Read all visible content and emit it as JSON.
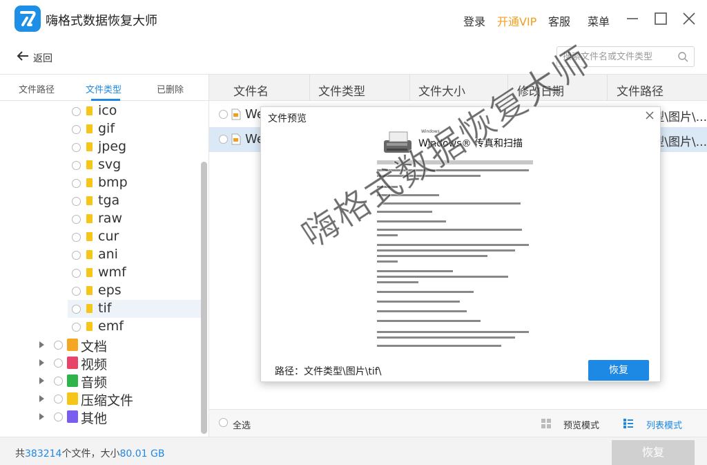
{
  "app": {
    "title": "嗨格式数据恢复大师"
  },
  "titlebar": {
    "login": "登录",
    "vip": "开通VIP",
    "service": "客服",
    "menu": "菜单"
  },
  "nav": {
    "back": "返回"
  },
  "search": {
    "placeholder": "搜索文件名或文件类型"
  },
  "left_tabs": {
    "path": "文件路径",
    "type": "文件类型",
    "deleted": "已删除",
    "active": "type"
  },
  "tree": {
    "extensions": [
      "ico",
      "gif",
      "jpeg",
      "svg",
      "bmp",
      "tga",
      "raw",
      "cur",
      "ani",
      "wmf",
      "eps",
      "tif",
      "emf"
    ],
    "selected": "tif",
    "categories": [
      {
        "label": "文档",
        "icon": "document-icon",
        "color": "#f5a623"
      },
      {
        "label": "视频",
        "icon": "video-icon",
        "color": "#e8446a"
      },
      {
        "label": "音频",
        "icon": "audio-icon",
        "color": "#2fb44a"
      },
      {
        "label": "压缩文件",
        "icon": "zip-icon",
        "color": "#f5c518"
      },
      {
        "label": "其他",
        "icon": "other-icon",
        "color": "#7b5cf0"
      }
    ]
  },
  "table": {
    "columns": [
      "文件名",
      "文件类型",
      "文件大小",
      "修改日期",
      "文件路径"
    ],
    "rows": [
      {
        "name": "We",
        "path": "型\\图片\\..."
      },
      {
        "name": "We",
        "path": "型\\图片\\..."
      }
    ],
    "selected_row": 1
  },
  "footer": {
    "select_all": "全选",
    "preview_mode": "预览模式",
    "list_mode": "列表模式"
  },
  "status": {
    "prefix": "共",
    "count": "383214",
    "mid": "个文件，大小",
    "size": "80.01 GB",
    "recover": "恢复"
  },
  "preview": {
    "title": "文件预览",
    "doc_sub": "Windows",
    "doc_heading": "Windows® 传真和扫描",
    "path": "路径：文件类型\\图片\\tif\\",
    "recover": "恢复"
  },
  "watermark": "嗨格式数据恢复大师",
  "colors": {
    "accent": "#1e88e5",
    "vip": "#f0a020"
  }
}
